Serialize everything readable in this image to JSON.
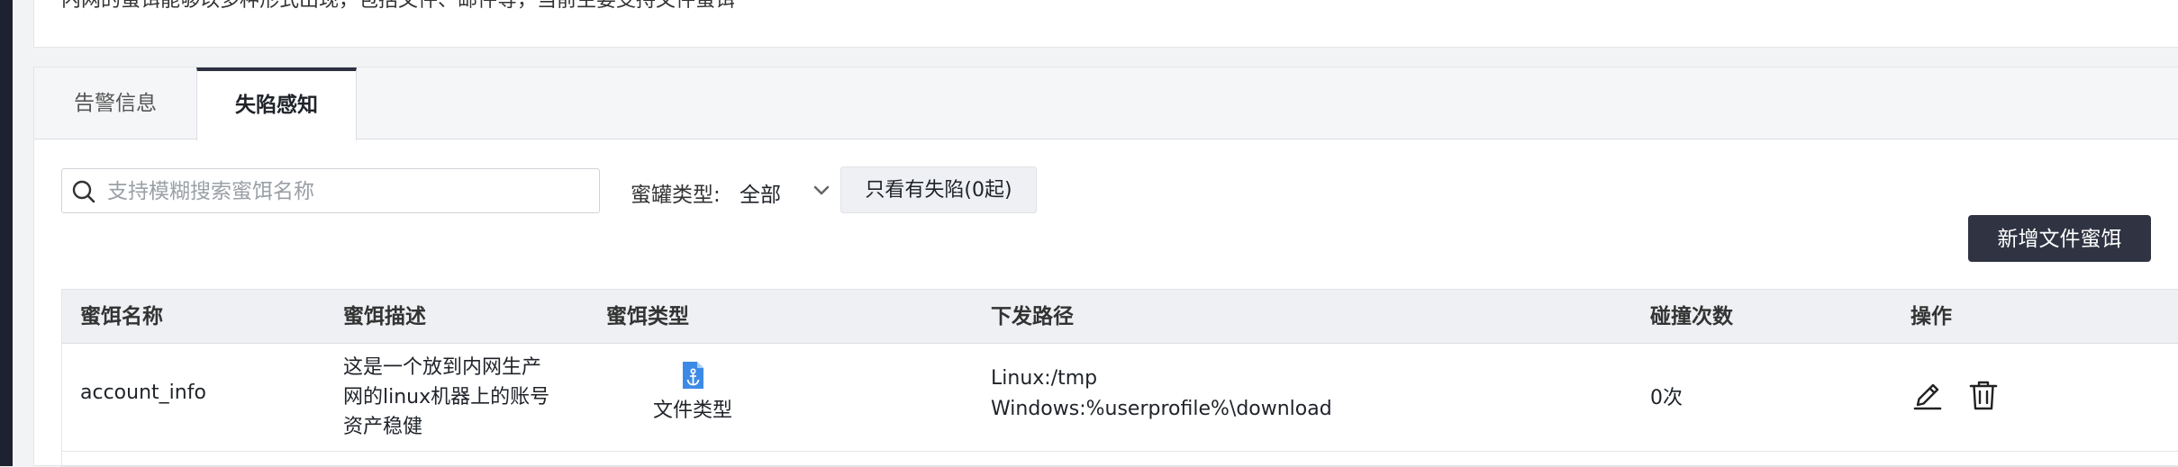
{
  "notice": {
    "text": "内网的蜜饵能够以多种形式出现，包括文件、邮件等，当前主要支持文件蜜饵"
  },
  "tabs": [
    {
      "label": "告警信息",
      "active": false
    },
    {
      "label": "失陷感知",
      "active": true
    }
  ],
  "search": {
    "placeholder": "支持模糊搜索蜜饵名称",
    "value": "",
    "icon": "search-icon"
  },
  "filter": {
    "label": "蜜罐类型:",
    "selected": "全部",
    "icon": "chevron-down-icon"
  },
  "only_compromised_button": "只看有失陷(0起)",
  "add_button": "新增文件蜜饵",
  "table": {
    "headers": [
      "蜜饵名称",
      "蜜饵描述",
      "蜜饵类型",
      "下发路径",
      "碰撞次数",
      "操作"
    ],
    "rows": [
      {
        "name": "account_info",
        "description": "这是一个放到内网生产网的linux机器上的账号资产稳健",
        "type_icon": "file-anchor-icon",
        "type_label": "文件类型",
        "path_linux": "Linux:/tmp",
        "path_windows": "Windows:%userprofile%\\download",
        "count": "0次",
        "actions": [
          "edit-icon",
          "delete-icon"
        ]
      }
    ]
  },
  "colors": {
    "primary_dark": "#2f3342",
    "accent_blue": "#3d8ae6",
    "page_bg": "#f2f3f5"
  }
}
